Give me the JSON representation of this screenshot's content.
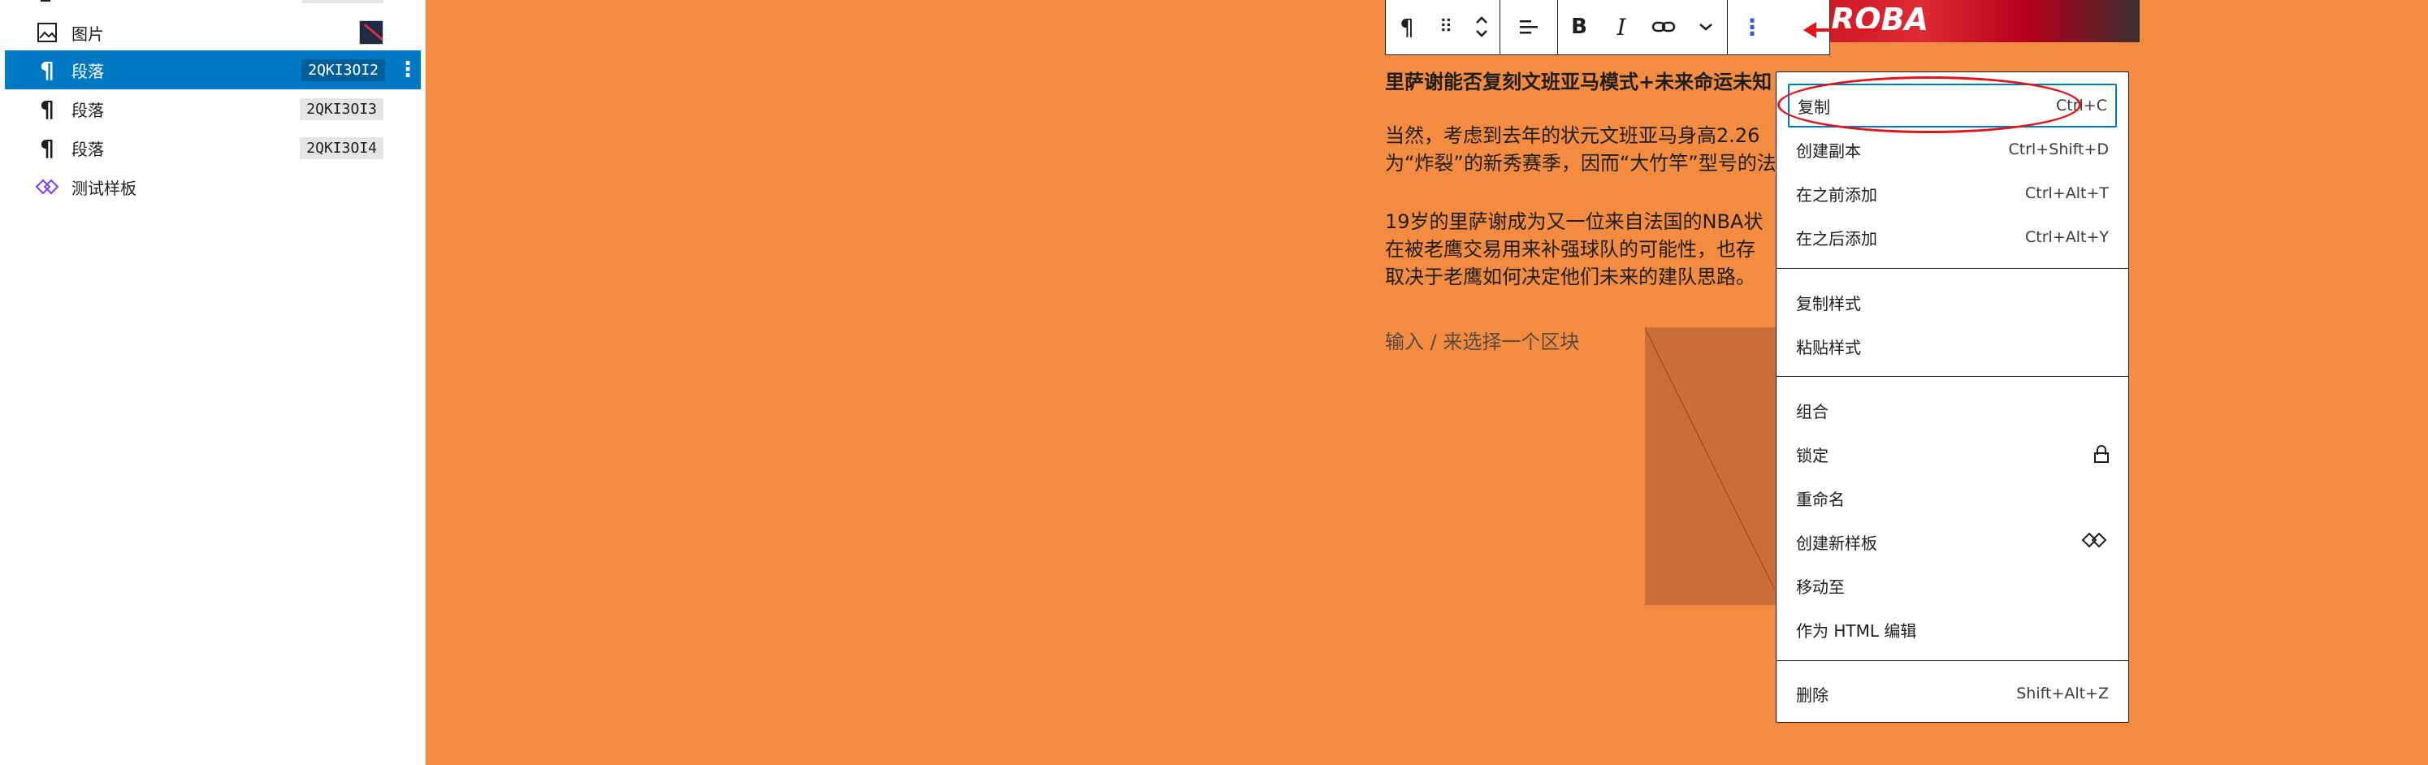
{
  "sidebar": {
    "items": [
      {
        "label": "图片",
        "icon": "image-icon"
      },
      {
        "label": "段落",
        "icon": "paragraph-icon",
        "badge": "2QKI3OI2",
        "active": true
      },
      {
        "label": "段落",
        "icon": "paragraph-icon",
        "badge": "2QKI3OI3"
      },
      {
        "label": "段落",
        "icon": "paragraph-icon",
        "badge": "2QKI3OI4"
      },
      {
        "label": "测试样板",
        "icon": "pattern-icon"
      }
    ],
    "active_color": "#0077c2"
  },
  "toolbar": {
    "buttons": {
      "paragraph": "¶",
      "drag": "⠿",
      "move": "⌃⌄",
      "align": "☰",
      "bold": "B",
      "italic": "I",
      "link": "⛓",
      "more_rich": "⌄",
      "options": "⋮"
    }
  },
  "editor": {
    "title": "里萨谢能否复刻文班亚马模式+未来命运未知",
    "p1_line1": "当然，考虑到去年的状元文班亚马身高2.26",
    "p1_line2": "为“炸裂”的新秀赛季，因而“大竹竿”型号的法",
    "p2_line1": "19岁的里萨谢成为又一位来自法国的NBA状",
    "p2_line2": "在被老鹰交易用来补强球队的可能性，也存",
    "p2_line3": "取决于老鹰如何决定他们未来的建队思路。",
    "placeholder": "输入 / 来选择一个区块",
    "background_color": "#f38b41"
  },
  "menu": {
    "copy": {
      "label": "复制",
      "shortcut": "Ctrl+C"
    },
    "duplicate": {
      "label": "创建副本",
      "shortcut": "Ctrl+Shift+D"
    },
    "insert_before": {
      "label": "在之前添加",
      "shortcut": "Ctrl+Alt+T"
    },
    "insert_after": {
      "label": "在之后添加",
      "shortcut": "Ctrl+Alt+Y"
    },
    "copy_styles": {
      "label": "复制样式"
    },
    "paste_styles": {
      "label": "粘贴样式"
    },
    "group": {
      "label": "组合"
    },
    "lock": {
      "label": "锁定",
      "icon": "lock-icon"
    },
    "rename": {
      "label": "重命名"
    },
    "create_pattern": {
      "label": "创建新样板",
      "icon": "pattern-icon"
    },
    "move_to": {
      "label": "移动至"
    },
    "edit_html": {
      "label": "作为 HTML 编辑"
    },
    "delete": {
      "label": "删除",
      "shortcut": "Shift+Alt+Z"
    }
  },
  "annotation": {
    "color": "#e0151a"
  }
}
